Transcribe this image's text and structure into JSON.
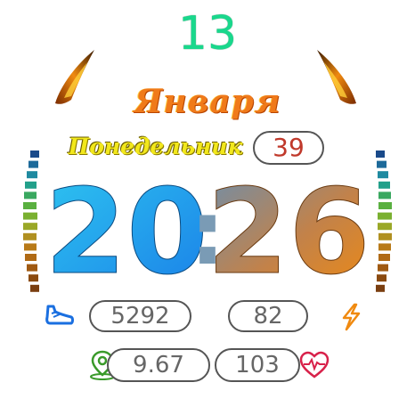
{
  "date": {
    "day": "13",
    "month": "Января",
    "weekday": "Понедельник",
    "week_number": "39"
  },
  "time": {
    "hours": "20",
    "separator": ":",
    "minutes": "26"
  },
  "stats": {
    "steps": "5292",
    "battery": "82",
    "distance": "9.67",
    "heart_rate": "103"
  },
  "colors": {
    "day": "#19d88c",
    "month": "#f07a1a",
    "weekday": "#f2e81c",
    "week_number": "#c0392b",
    "hours_gradient": [
      "#2ec5f0",
      "#1a7fe8"
    ],
    "minutes_gradient": [
      "#6a8fb0",
      "#f08a10"
    ]
  },
  "icons": {
    "steps": "shoe-icon",
    "battery": "lightning-icon",
    "distance": "location-pin-icon",
    "heart": "heart-pulse-icon"
  }
}
